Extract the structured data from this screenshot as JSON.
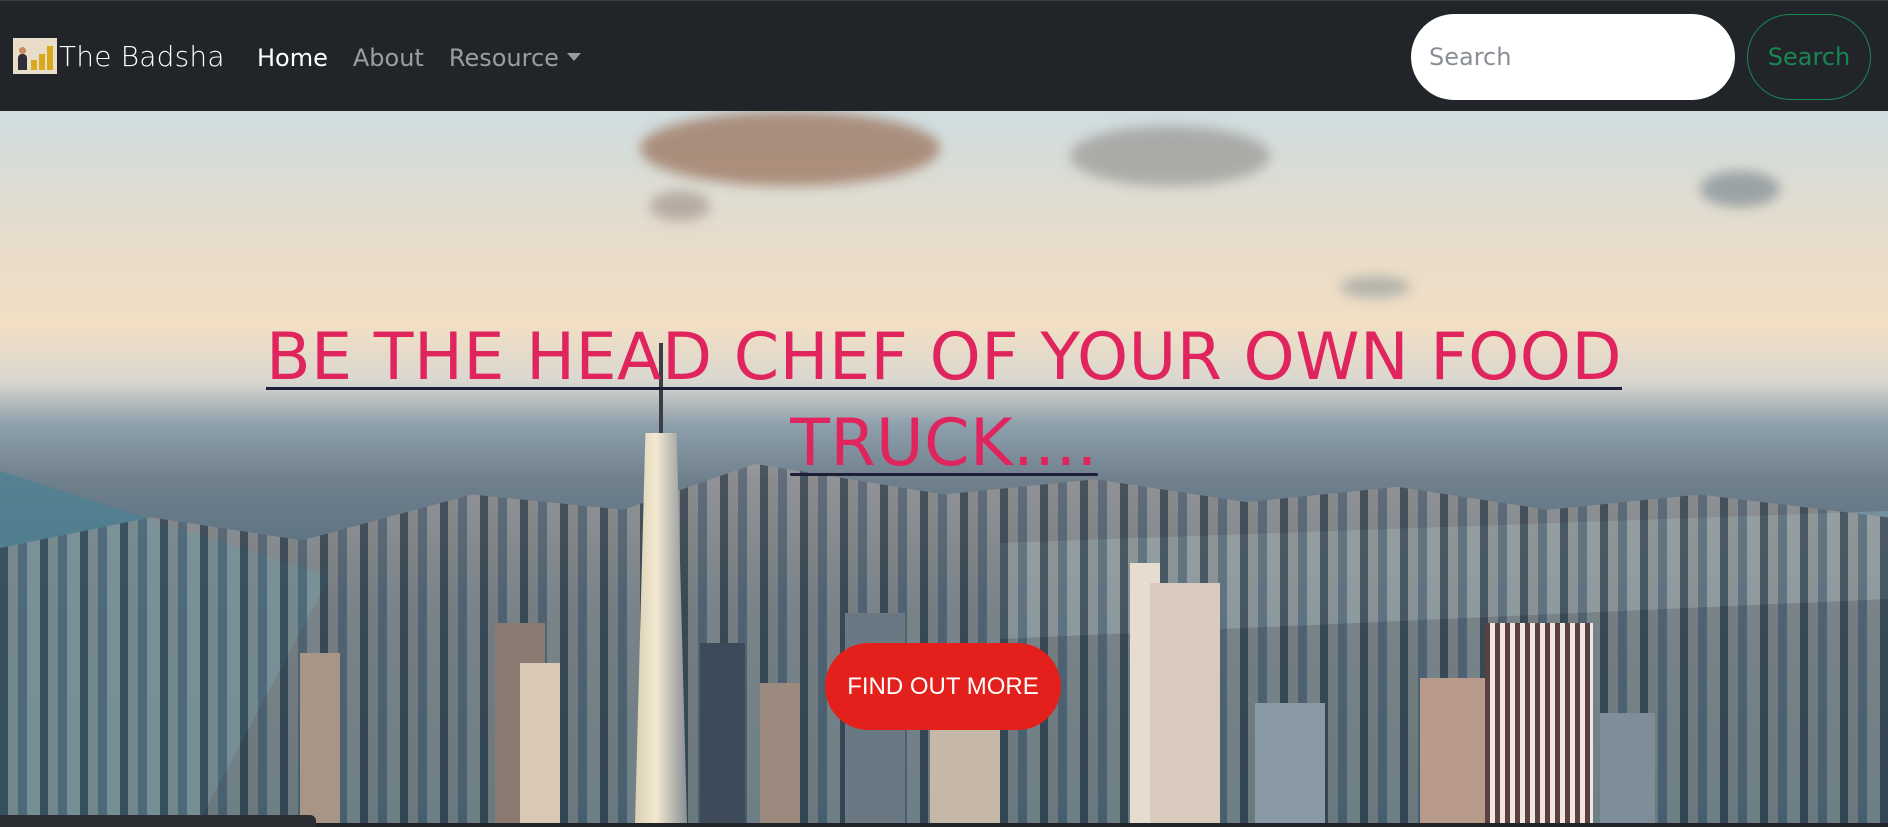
{
  "navbar": {
    "brand_name": "The Badsha",
    "brand_logo": "chart-logo-icon",
    "links": [
      {
        "label": "Home",
        "active": true
      },
      {
        "label": "About",
        "active": false
      },
      {
        "label": "Resource",
        "active": false,
        "dropdown": true
      }
    ],
    "search": {
      "placeholder": "Search",
      "button_label": "Search"
    },
    "colors": {
      "background": "#212529",
      "search_button": "#198754",
      "active_link": "#ffffff",
      "inactive_link": "#8a8d90"
    }
  },
  "hero": {
    "headline": "BE THE HEAD CHEF OF YOUR OWN FOOD TRUCK....",
    "cta_label": "FIND OUT MORE",
    "background_image": "city-skyline-aerial",
    "colors": {
      "headline": "#e0245e",
      "cta_background": "#e3201b",
      "cta_text": "#ffffff"
    }
  }
}
